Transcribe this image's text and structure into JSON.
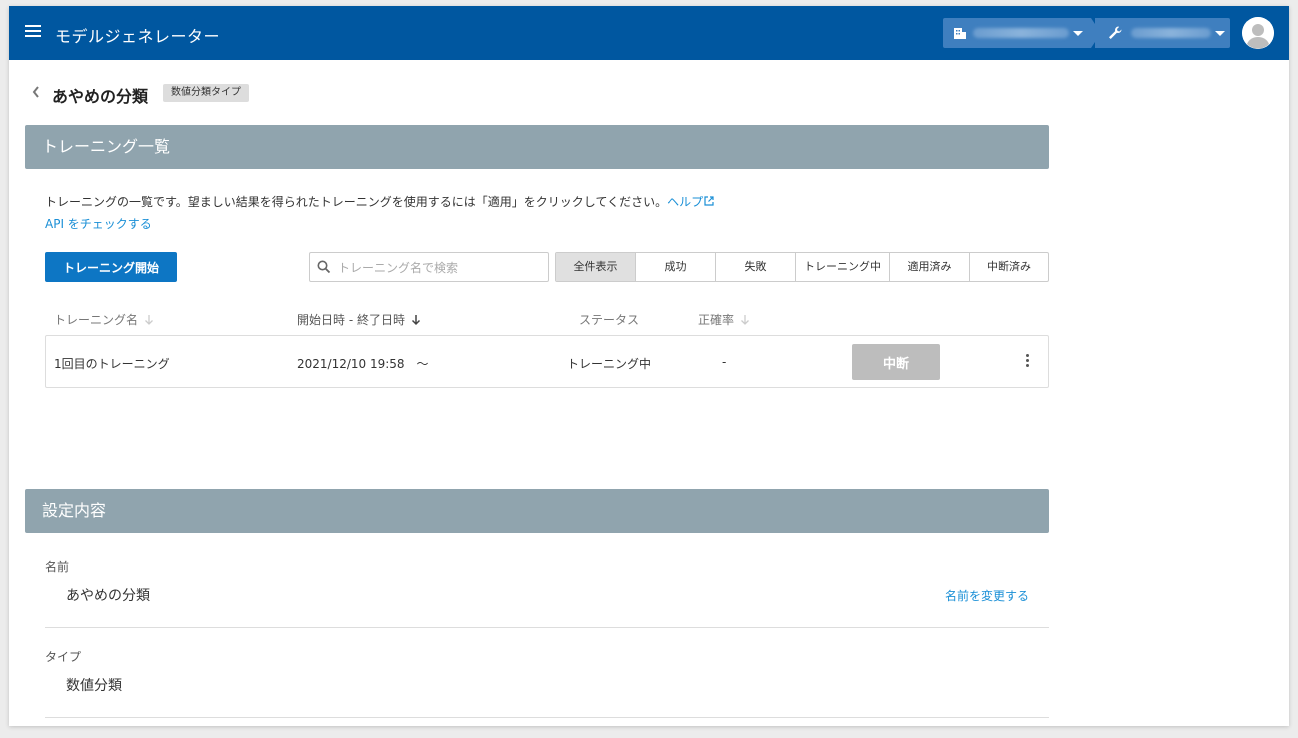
{
  "header": {
    "app_title": "モデルジェネレーター",
    "org_icon": "building-icon",
    "project_icon": "wrench-icon"
  },
  "page": {
    "title": "あやめの分類",
    "type_badge": "数値分類タイプ"
  },
  "training_section": {
    "heading": "トレーニング一覧",
    "description": "トレーニングの一覧です。望ましい結果を得られたトレーニングを使用するには「適用」をクリックしてください。",
    "help_link": "ヘルプ",
    "api_link": "API をチェックする",
    "start_button": "トレーニング開始",
    "search_placeholder": "トレーニング名で検索",
    "filters": [
      "全件表示",
      "成功",
      "失敗",
      "トレーニング中",
      "適用済み",
      "中断済み"
    ],
    "columns": {
      "name": "トレーニング名",
      "datetime": "開始日時 - 終了日時",
      "status": "ステータス",
      "accuracy": "正確率"
    },
    "rows": [
      {
        "name": "1回目のトレーニング",
        "datetime": "2021/12/10 19:58　〜",
        "status": "トレーニング中",
        "accuracy": "-",
        "action": "中断"
      }
    ]
  },
  "settings_section": {
    "heading": "設定内容",
    "name_label": "名前",
    "name_value": "あやめの分類",
    "rename_link": "名前を変更する",
    "type_label": "タイプ",
    "type_value": "数値分類"
  },
  "colors": {
    "header_bg": "#0057a0",
    "section_bg": "#90a4ae",
    "primary_button": "#0d76c4",
    "link": "#1a8fd6",
    "disabled_button": "#bdbdbd"
  }
}
